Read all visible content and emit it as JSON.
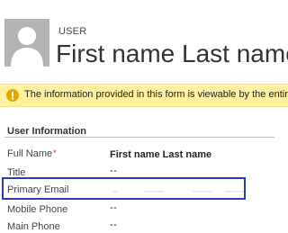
{
  "header": {
    "entity_type": "USER",
    "record_title": "First name Last name"
  },
  "notification": {
    "icon": "warning-icon",
    "text": "The information provided in this form is viewable by the entire organization.",
    "color": "#fff19d"
  },
  "section": {
    "title": "User Information"
  },
  "fields": {
    "full_name": {
      "label": "Full Name",
      "required_mark": "*",
      "value": "First name Last name"
    },
    "title": {
      "label": "Title",
      "value": "--"
    },
    "primary_email": {
      "label": "Primary Email",
      "value": ""
    },
    "mobile_phone": {
      "label": "Mobile Phone",
      "value": "--"
    },
    "main_phone": {
      "label": "Main Phone",
      "value": "--"
    }
  },
  "colors": {
    "highlight": "#2b3ea9",
    "avatar_bg": "#b3b3b3",
    "required": "#c41e1e"
  }
}
